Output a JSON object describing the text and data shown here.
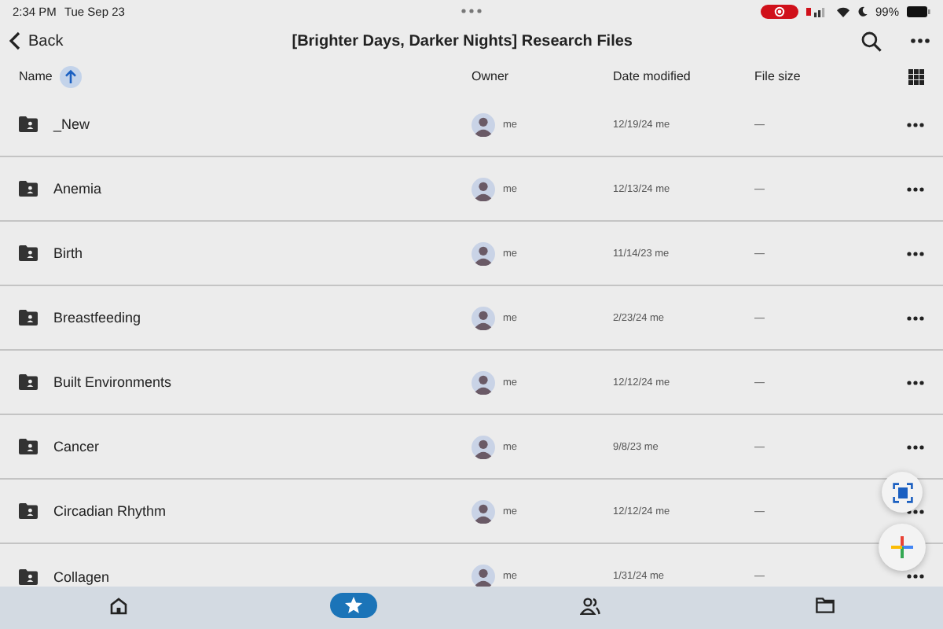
{
  "status_bar": {
    "time": "2:34 PM",
    "date": "Tue Sep 23",
    "battery": "99%"
  },
  "header": {
    "back": "Back",
    "title": "[Brighter Days, Darker Nights] Research Files"
  },
  "columns": {
    "name": "Name",
    "owner": "Owner",
    "date_modified": "Date modified",
    "file_size": "File size"
  },
  "rows": [
    {
      "name": "_New",
      "owner": "me",
      "modified": "12/19/24 me",
      "size": "—"
    },
    {
      "name": "Anemia",
      "owner": "me",
      "modified": "12/13/24 me",
      "size": "—"
    },
    {
      "name": "Birth",
      "owner": "me",
      "modified": "11/14/23 me",
      "size": "—"
    },
    {
      "name": "Breastfeeding",
      "owner": "me",
      "modified": "2/23/24 me",
      "size": "—"
    },
    {
      "name": "Built Environments",
      "owner": "me",
      "modified": "12/12/24 me",
      "size": "—"
    },
    {
      "name": "Cancer",
      "owner": "me",
      "modified": "9/8/23 me",
      "size": "—"
    },
    {
      "name": "Circadian Rhythm",
      "owner": "me",
      "modified": "12/12/24 me",
      "size": "—"
    },
    {
      "name": "Collagen",
      "owner": "me",
      "modified": "1/31/24 me",
      "size": "—"
    }
  ],
  "nav": [
    {
      "kind": "home",
      "selected": false
    },
    {
      "kind": "star",
      "selected": true
    },
    {
      "kind": "people",
      "selected": false
    },
    {
      "kind": "folder",
      "selected": false
    }
  ]
}
